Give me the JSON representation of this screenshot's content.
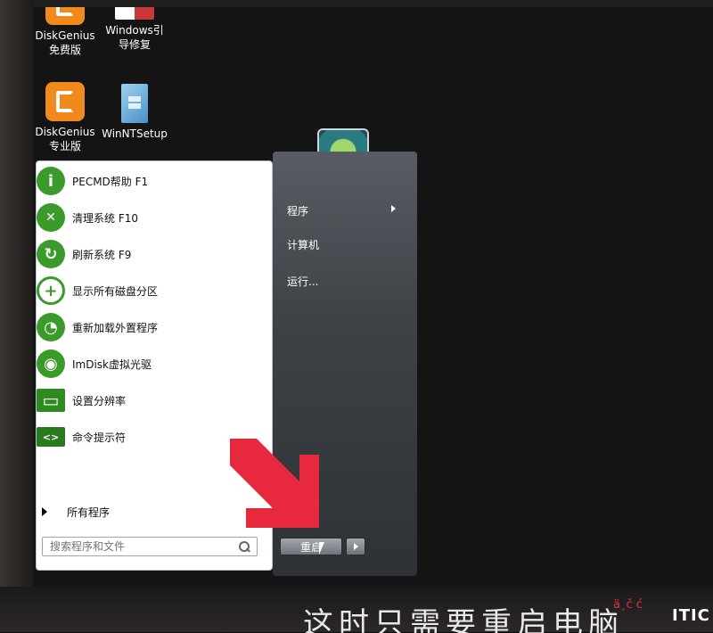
{
  "desktop": {
    "icons": [
      {
        "label_line1": "DiskGenius",
        "label_line2": "免费版",
        "icon": "diskgenius-free-icon"
      },
      {
        "label_line1": "Windows引",
        "label_line2": "导修复",
        "icon": "boot-repair-icon"
      },
      {
        "label_line1": "DiskGenius",
        "label_line2": "专业版",
        "icon": "diskgenius-pro-icon"
      },
      {
        "label_line1": "WinNTSetup",
        "label_line2": "",
        "icon": "winntsetup-icon"
      }
    ]
  },
  "start_menu": {
    "items": [
      {
        "label": "PECMD帮助 F1",
        "icon": "info-icon",
        "glyph": "i"
      },
      {
        "label": "清理系统 F10",
        "icon": "clean-icon",
        "glyph": "✕"
      },
      {
        "label": "刷新系统 F9",
        "icon": "refresh-icon",
        "glyph": "↻"
      },
      {
        "label": "显示所有磁盘分区",
        "icon": "show-partitions-icon",
        "glyph": "+"
      },
      {
        "label": "重新加载外置程序",
        "icon": "reload-icon",
        "glyph": "◔"
      },
      {
        "label": "ImDisk虚拟光驱",
        "icon": "virtual-drive-icon",
        "glyph": "◉"
      },
      {
        "label": "设置分辨率",
        "icon": "monitor-icon",
        "glyph": "▭"
      },
      {
        "label": "命令提示符",
        "icon": "cmd-icon",
        "glyph": "<>"
      }
    ],
    "all_programs_label": "所有程序",
    "search_placeholder": "搜索程序和文件",
    "right_pane": {
      "programs": "程序",
      "computer": "计算机",
      "run": "运行..."
    },
    "restart_label": "重启",
    "accent_green": "#3a9a2a"
  },
  "overlay": {
    "subtitle": "这时只需要重启电脑",
    "watermark_small": "ä¸č ć",
    "watermark_logo": "ITIC"
  }
}
